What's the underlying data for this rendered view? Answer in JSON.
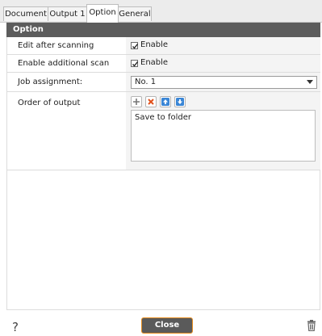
{
  "tabs": [
    {
      "label": "Document",
      "active": false
    },
    {
      "label": "Output 1",
      "active": false
    },
    {
      "label": "Option",
      "active": true
    },
    {
      "label": "General",
      "active": false
    }
  ],
  "section": {
    "title": "Option"
  },
  "rows": {
    "edit_after_scanning": {
      "label": "Edit after scanning",
      "checkbox_label": "Enable",
      "checked": true
    },
    "additional_scan": {
      "label": "Enable additional scan",
      "checkbox_label": "Enable",
      "checked": true
    },
    "job_assignment": {
      "label": "Job assignment:",
      "value": "No. 1"
    },
    "order_of_output": {
      "label": "Order of output",
      "items": [
        "Save to folder"
      ]
    }
  },
  "toolbar_icons": [
    "add-icon",
    "delete-icon",
    "move-up-icon",
    "move-down-icon"
  ],
  "footer": {
    "help_label": "?",
    "close_label": "Close"
  },
  "colors": {
    "header_bg": "#5c5c5c",
    "close_border": "#e58b1c",
    "delete_red": "#e0501b",
    "arrow_blue": "#3a86d6"
  }
}
